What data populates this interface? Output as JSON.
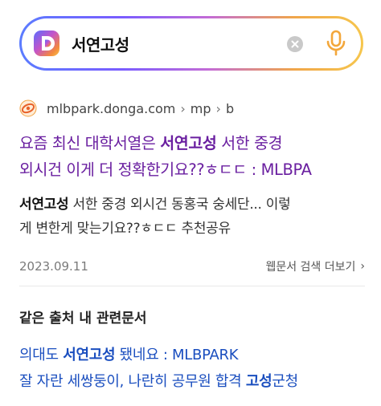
{
  "search": {
    "query": "서연고성"
  },
  "icons": {
    "logo": "daum-logo-icon",
    "clear": "clear-circle-icon",
    "mic": "microphone-icon",
    "favicon": "site-favicon-icon",
    "more_chevron": "chevron-right-icon"
  },
  "result": {
    "source": {
      "domain": "mlbpark.donga.com",
      "path1": "mp",
      "path2": "b"
    },
    "title": {
      "line1_prefix": "요즘 최신 대학서열은 ",
      "line1_bold": "서연고성",
      "line1_suffix": " 서한 중경",
      "line2": "외시건 이게 더 정확한기요??ㅎㄷㄷ : MLBPA"
    },
    "snippet": {
      "bold": "서연고성",
      "line1_rest": " 서한 중경 외시건 동홍국 숭세단... 이렇",
      "line2": "게 변한게 맞는기요??ㅎㄷㄷ 추천공유"
    },
    "date": "2023.09.11",
    "more_label": "웹문서 검색 더보기",
    "more_chevron": "›"
  },
  "related": {
    "heading": "같은 출처 내 관련문서",
    "items": [
      {
        "prefix": "의대도 ",
        "bold": "서연고성",
        "suffix": " 됐네요 : MLBPARK"
      },
      {
        "prefix": "잘 자란 세쌍둥이, 나란히 공무원 합격 ",
        "bold": "고성",
        "suffix": "군청"
      }
    ]
  },
  "colors": {
    "title": "#6a1fa0",
    "link": "#1a4ebf",
    "border_gradient": [
      "#5b7cff",
      "#c36bd6",
      "#f6c64d"
    ]
  }
}
